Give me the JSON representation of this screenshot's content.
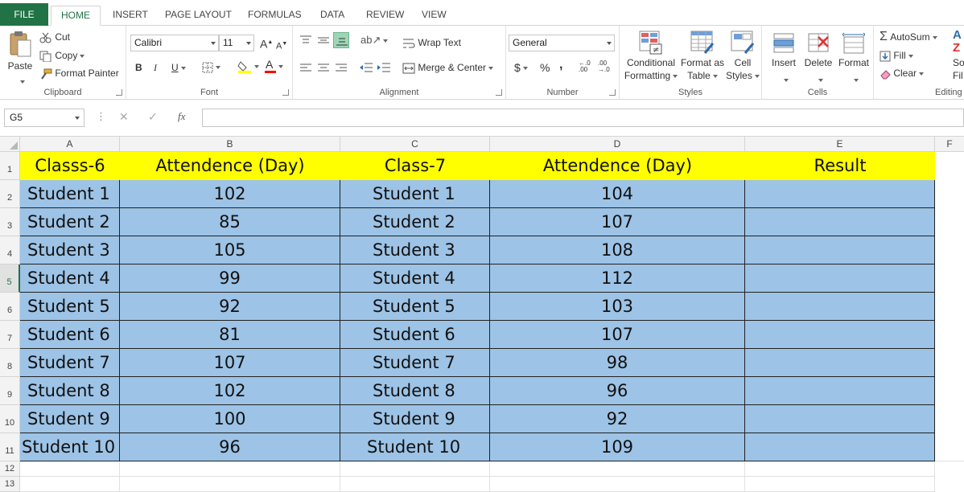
{
  "ribbon_tabs": [
    {
      "label": "FILE"
    },
    {
      "label": "HOME"
    },
    {
      "label": "INSERT"
    },
    {
      "label": "PAGE LAYOUT"
    },
    {
      "label": "FORMULAS"
    },
    {
      "label": "DATA"
    },
    {
      "label": "REVIEW"
    },
    {
      "label": "VIEW"
    }
  ],
  "clipboard": {
    "paste": "Paste",
    "cut": "Cut",
    "copy": "Copy",
    "format_painter": "Format Painter",
    "group": "Clipboard"
  },
  "font": {
    "family": "Calibri",
    "size": "11",
    "bold": "B",
    "italic": "I",
    "underline": "U",
    "grow": "A",
    "shrink": "A",
    "font_color_glyph": "A",
    "group": "Font",
    "highlight_color": "#ffff00",
    "font_color": "#ff0000"
  },
  "alignment": {
    "wrap_text": "Wrap Text",
    "merge_center": "Merge & Center",
    "group": "Alignment"
  },
  "number": {
    "format": "General",
    "currency": "$",
    "percent": "%",
    "comma": ",",
    "group": "Number"
  },
  "styles": {
    "conditional_l1": "Conditional",
    "conditional_l2": "Formatting",
    "table_l1": "Format as",
    "table_l2": "Table",
    "cell_l1": "Cell",
    "cell_l2": "Styles",
    "group": "Styles"
  },
  "cells_group": {
    "insert": "Insert",
    "delete": "Delete",
    "format": "Format",
    "group": "Cells"
  },
  "editing": {
    "autosum": "AutoSum",
    "fill": "Fill",
    "clear": "Clear",
    "sort_l1": "So",
    "sort_l2": "Fil",
    "group": "Editing"
  },
  "formula_bar": {
    "name_box": "G5",
    "fx": "fx",
    "content": ""
  },
  "columns": [
    "A",
    "B",
    "C",
    "D",
    "E",
    "F"
  ],
  "rows": [
    "1",
    "2",
    "3",
    "4",
    "5",
    "6",
    "7",
    "8",
    "9",
    "10",
    "11",
    "12",
    "13"
  ],
  "selected_row": "5",
  "sheet": {
    "headers": [
      "Classs-6",
      "Attendence (Day)",
      "Class-7",
      "Attendence (Day)",
      "Result"
    ],
    "records": [
      {
        "class6": "Student 1",
        "att6": "102",
        "class7": "Student 1",
        "att7": "104",
        "result": ""
      },
      {
        "class6": "Student 2",
        "att6": "85",
        "class7": "Student 2",
        "att7": "107",
        "result": ""
      },
      {
        "class6": "Student 3",
        "att6": "105",
        "class7": "Student 3",
        "att7": "108",
        "result": ""
      },
      {
        "class6": "Student 4",
        "att6": "99",
        "class7": "Student 4",
        "att7": "112",
        "result": ""
      },
      {
        "class6": "Student 5",
        "att6": "92",
        "class7": "Student 5",
        "att7": "103",
        "result": ""
      },
      {
        "class6": "Student 6",
        "att6": "81",
        "class7": "Student 6",
        "att7": "107",
        "result": ""
      },
      {
        "class6": "Student 7",
        "att6": "107",
        "class7": "Student 7",
        "att7": "98",
        "result": ""
      },
      {
        "class6": "Student 8",
        "att6": "102",
        "class7": "Student 8",
        "att7": "96",
        "result": ""
      },
      {
        "class6": "Student 9",
        "att6": "100",
        "class7": "Student 9",
        "att7": "92",
        "result": ""
      },
      {
        "class6": "Student 10",
        "att6": "96",
        "class7": "Student 10",
        "att7": "109",
        "result": ""
      }
    ],
    "header_fill": "#ffff00",
    "body_fill": "#9dc3e6"
  },
  "accent_color": "#217346"
}
